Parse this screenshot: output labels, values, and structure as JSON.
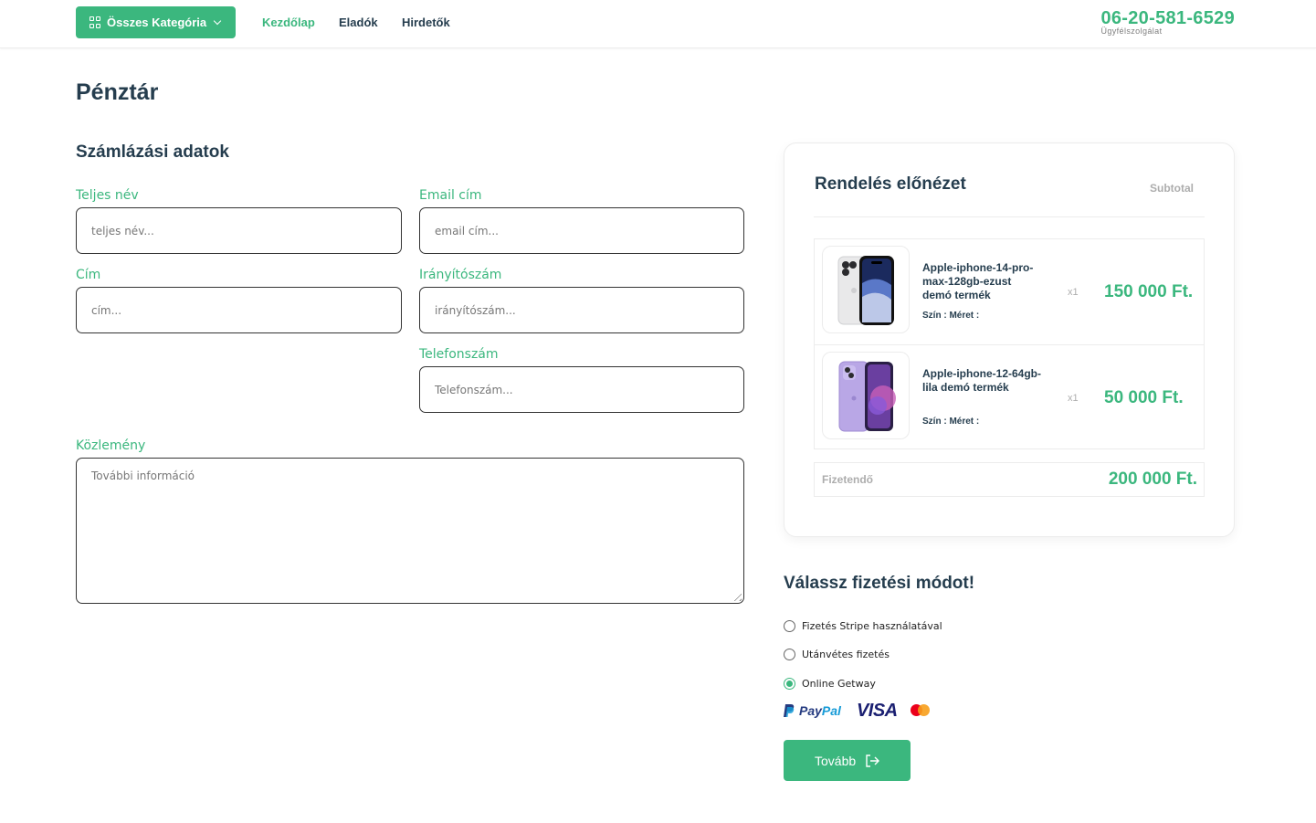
{
  "header": {
    "category_button": "Összes Kategória",
    "nav": [
      "Kezdőlap",
      "Eladók",
      "Hirdetők"
    ],
    "phone": "06-20-581-6529",
    "phone_sub": "Ügyfélszolgálat"
  },
  "page": {
    "title": "Pénztár",
    "billing_title": "Számlázási adatok"
  },
  "form": {
    "full_name": {
      "label": "Teljes név",
      "placeholder": "teljes név..."
    },
    "email": {
      "label": "Email cím",
      "placeholder": "email cím..."
    },
    "address": {
      "label": "Cím",
      "placeholder": "cím..."
    },
    "zip": {
      "label": "Irányítószám",
      "placeholder": "irányítószám..."
    },
    "phone": {
      "label": "Telefonszám",
      "placeholder": "Telefonszám..."
    },
    "note": {
      "label": "Közlemény",
      "placeholder": "További információ"
    }
  },
  "order": {
    "title": "Rendelés előnézet",
    "subtotal_label": "Subtotal",
    "items": [
      {
        "name": "Apple-iphone-14-pro-max-128gb-ezust demó termék",
        "meta": "Szín : Méret :",
        "qty": "x1",
        "price": "150 000 Ft."
      },
      {
        "name": "Apple-iphone-12-64gb-lila demó termék",
        "meta": "Szín : Méret :",
        "qty": "x1",
        "price": "50 000 Ft."
      }
    ],
    "total_label": "Fizetendő",
    "total_value": "200 000 Ft."
  },
  "payment": {
    "title": "Válassz fizetési módot!",
    "options": [
      {
        "label": "Fizetés Stripe használatával",
        "checked": false
      },
      {
        "label": "Utánvétes fizetés",
        "checked": false
      },
      {
        "label": "Online Getway",
        "checked": true
      }
    ],
    "logos": {
      "paypal_a": "Pay",
      "paypal_b": "Pal",
      "visa": "VISA"
    },
    "next_button": "Tovább"
  },
  "colors": {
    "accent": "#3bb77e",
    "heading": "#253d4e",
    "muted": "#adadad"
  }
}
